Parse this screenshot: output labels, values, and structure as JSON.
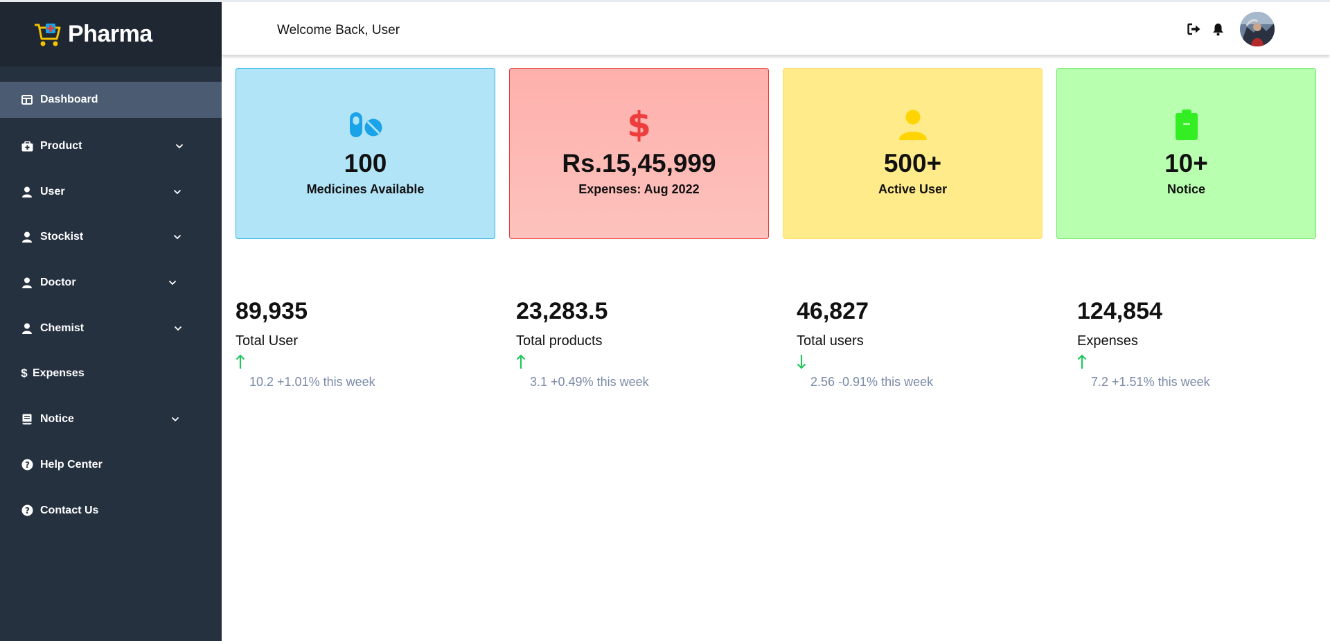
{
  "app": {
    "brand": "Pharma"
  },
  "header": {
    "welcome": "Welcome Back, User"
  },
  "sidebar": {
    "items": [
      {
        "label": "Dashboard",
        "icon": "dashboard-icon",
        "active": true,
        "has_submenu": false
      },
      {
        "label": "Product",
        "icon": "medkit-icon",
        "has_submenu": true
      },
      {
        "label": "User",
        "icon": "user-icon",
        "has_submenu": true
      },
      {
        "label": "Stockist",
        "icon": "user-icon",
        "has_submenu": true
      },
      {
        "label": "Doctor",
        "icon": "user-icon",
        "has_submenu": true
      },
      {
        "label": "Chemist",
        "icon": "user-icon",
        "has_submenu": true
      },
      {
        "label": "Expenses",
        "icon": "dollar-icon",
        "has_submenu": false
      },
      {
        "label": "Notice",
        "icon": "book-icon",
        "has_submenu": true
      },
      {
        "label": "Help Center",
        "icon": "help-icon",
        "has_submenu": false
      },
      {
        "label": "Contact Us",
        "icon": "help-icon",
        "has_submenu": false
      }
    ]
  },
  "cards": [
    {
      "value": "100",
      "label": "Medicines Available",
      "icon": "pills-icon",
      "icon_color": "#1aa3e8"
    },
    {
      "value": "Rs.15,45,999",
      "label": "Expenses: Aug 2022",
      "icon": "dollar-icon",
      "icon_color": "#ee3d3d"
    },
    {
      "value": "500+",
      "label": "Active User",
      "icon": "user-icon",
      "icon_color": "#ffd400"
    },
    {
      "value": "10+",
      "label": "Notice",
      "icon": "clipboard-icon",
      "icon_color": "#33ee22"
    }
  ],
  "stats": [
    {
      "value": "89,935",
      "label": "Total User",
      "direction": "up",
      "trend": "10.2 +1.01% this week"
    },
    {
      "value": "23,283.5",
      "label": "Total products",
      "direction": "up",
      "trend": "3.1 +0.49% this week"
    },
    {
      "value": "46,827",
      "label": "Total users",
      "direction": "down",
      "trend": "2.56 -0.91% this week"
    },
    {
      "value": "124,854",
      "label": "Expenses",
      "direction": "up",
      "trend": "7.2 +1.51% this week"
    }
  ],
  "colors": {
    "sidebar_bg": "#263140",
    "sidebar_brand_bg": "#1f2733",
    "sidebar_active_bg": "#4b5b72",
    "trend_green": "#22c55e",
    "trend_text": "#7a8aa8"
  }
}
